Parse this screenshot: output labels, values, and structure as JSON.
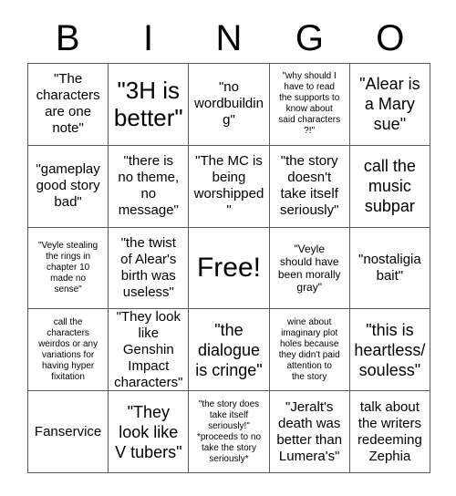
{
  "card": {
    "title_letters": [
      "B",
      "I",
      "N",
      "G",
      "O"
    ],
    "colors": {
      "background": "#ffffff",
      "grid_line": "#5a5a5a",
      "text": "#000000"
    },
    "cells": [
      {
        "text": "\"The\ncharacters\nare one\nnote\"",
        "size": "fs-md"
      },
      {
        "text": "\"3H is\nbetter\"",
        "size": "fs-xl"
      },
      {
        "text": "\"no\nwordbuilding\"",
        "size": "fs-md"
      },
      {
        "text": "\"why should I\nhave to read\nthe supports to\nknow about\nsaid characters\n?!\"",
        "size": "fs-xs"
      },
      {
        "text": "\"Alear is\na Mary\nsue\"",
        "size": "fs-lg"
      },
      {
        "text": "\"gameplay\ngood story\nbad\"",
        "size": "fs-md"
      },
      {
        "text": "\"there is\nno theme,\nno\nmessage\"",
        "size": "fs-md"
      },
      {
        "text": "\"The MC is\nbeing\nworshipped\"",
        "size": "fs-md"
      },
      {
        "text": "\"the story\ndoesn't\ntake itself\nseriously\"",
        "size": "fs-md"
      },
      {
        "text": "call the\nmusic\nsubpar",
        "size": "fs-lg"
      },
      {
        "text": "\"Veyle stealing\nthe rings in\nchapter 10\nmade no\nsense\"",
        "size": "fs-xs"
      },
      {
        "text": "\"the twist\nof Alear's\nbirth was\nuseless\"",
        "size": "fs-md"
      },
      {
        "text": "Free!",
        "size": "free"
      },
      {
        "text": "\"Veyle\nshould have\nbeen morally\ngray\"",
        "size": "fs-sm"
      },
      {
        "text": "\"nostaligia\nbait\"",
        "size": "fs-md"
      },
      {
        "text": "call the\ncharacters\nweirdos or any\nvariations for\nhaving hyper\nfixitation",
        "size": "fs-xs"
      },
      {
        "text": "\"They look\nlike Genshin\nImpact\ncharacters\"",
        "size": "fs-md"
      },
      {
        "text": "\"the\ndialogue\nis cringe\"",
        "size": "fs-lg"
      },
      {
        "text": "wine about\nimaginary plot\nholes because\nthey didn't paid\nattention to\nthe story",
        "size": "fs-xs"
      },
      {
        "text": "\"this is\nheartless/\nsouless\"",
        "size": "fs-lg"
      },
      {
        "text": "Fanservice",
        "size": "fs-md"
      },
      {
        "text": "\"They\nlook like\nV tubers\"",
        "size": "fs-lg"
      },
      {
        "text": "\"the story does\ntake itself\nseriously!\"\n*proceeds to no\ntake the story\nseriously*",
        "size": "fs-xs"
      },
      {
        "text": "\"Jeralt's\ndeath was\nbetter than\nLumera's\"",
        "size": "fs-md"
      },
      {
        "text": "talk about\nthe writers\nredeeming\nZephia",
        "size": "fs-md"
      }
    ]
  }
}
